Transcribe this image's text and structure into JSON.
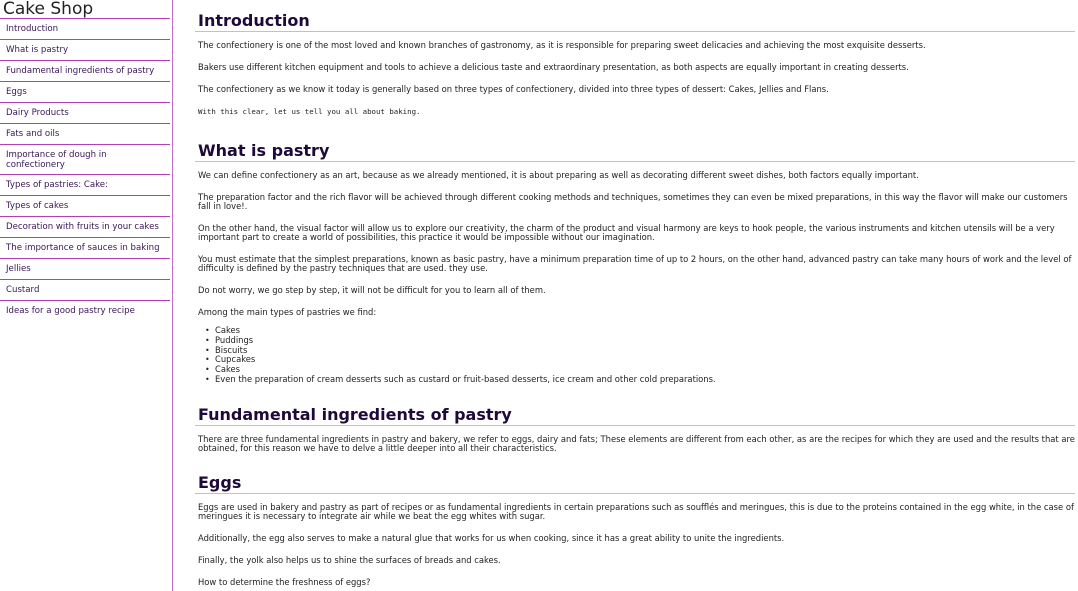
{
  "sidebar": {
    "title": "Cake Shop",
    "items": [
      {
        "label": "Introduction"
      },
      {
        "label": "What is pastry"
      },
      {
        "label": "Fundamental ingredients of pastry"
      },
      {
        "label": "Eggs"
      },
      {
        "label": "Dairy Products"
      },
      {
        "label": "Fats and oils"
      },
      {
        "label": "Importance of dough in confectionery"
      },
      {
        "label": "Types of pastries: Cake:"
      },
      {
        "label": "Types of cakes"
      },
      {
        "label": "Decoration with fruits in your cakes"
      },
      {
        "label": "The importance of sauces in baking"
      },
      {
        "label": "Jellies"
      },
      {
        "label": "Custard"
      },
      {
        "label": "Ideas for a good pastry recipe"
      }
    ]
  },
  "main": {
    "introduction": {
      "heading": "Introduction",
      "p1": "The confectionery is one of the most loved and known branches of gastronomy, as it is responsible for preparing sweet delicacies and achieving the most exquisite desserts.",
      "p2": "Bakers use different kitchen equipment and tools to achieve a delicious taste and extraordinary presentation, as both aspects are equally important in creating desserts.",
      "p3": "The confectionery as we know it today is generally based on three types of confectionery, divided into three types of dessert: Cakes, Jellies and Flans.",
      "code": "With this clear, let us tell you all about baking."
    },
    "what_is_pastry": {
      "heading": "What is pastry",
      "p1": "We can define confectionery as an art, because as we already mentioned, it is about preparing as well as decorating different sweet dishes, both factors equally important.",
      "p2": "The preparation factor and the rich flavor will be achieved through different cooking methods and techniques, sometimes they can even be mixed preparations, in this way the flavor will make our customers fall in love!.",
      "p3": "On the other hand, the visual factor will allow us to explore our creativity, the charm of the product and visual harmony are keys to hook people, the various instruments and kitchen utensils will be a very important part to create a world of possibilities, this practice it would be impossible without our imagination.",
      "p4": "You must estimate that the simplest preparations, known as basic pastry, have a minimum preparation time of up to 2 hours, on the other hand, advanced pastry can take many hours of work and the level of difficulty is defined by the pastry techniques that are used. they use.",
      "p5": "Do not worry, we go step by step, it will not be difficult for you to learn all of them.",
      "p6": "Among the main types of pastries we find:",
      "list": [
        "Cakes",
        "Puddings",
        "Biscuits",
        "Cupcakes",
        "Cakes",
        "Even the preparation of cream desserts such as custard or fruit-based desserts, ice cream and other cold preparations."
      ]
    },
    "ingredients": {
      "heading": "Fundamental ingredients of pastry",
      "p1": "There are three fundamental ingredients in pastry and bakery, we refer to eggs, dairy and fats; These elements are different from each other, as are the recipes for which they are used and the results that are obtained, for this reason we have to delve a little deeper into all their characteristics."
    },
    "eggs": {
      "heading": "Eggs",
      "p1": "Eggs are used in bakery and pastry as part of recipes or as fundamental ingredients in certain preparations such as soufflés and meringues, this is due to the proteins contained in the egg white, in the case of meringues it is necessary to integrate air while we beat the egg whites with sugar.",
      "p2": "Additionally, the egg also serves to make a natural glue that works for us when cooking, since it has a great ability to unite the ingredients.",
      "p3": "Finally, the yolk also helps us to shine the surfaces of breads and cakes.",
      "p4": "How to determine the freshness of eggs?"
    }
  }
}
